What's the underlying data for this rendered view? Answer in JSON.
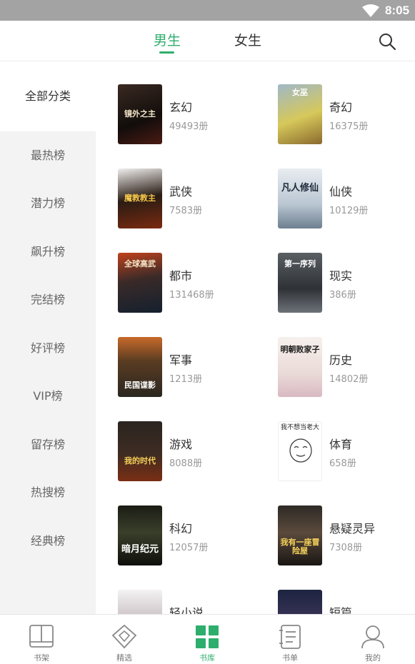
{
  "status_bar": {
    "time": "8:05"
  },
  "header": {
    "tabs": [
      {
        "label": "男生",
        "active": true
      },
      {
        "label": "女生",
        "active": false
      }
    ]
  },
  "sidebar": {
    "items": [
      {
        "label": "全部分类",
        "active": true
      },
      {
        "label": "最热榜"
      },
      {
        "label": "潜力榜"
      },
      {
        "label": "飙升榜"
      },
      {
        "label": "完结榜"
      },
      {
        "label": "好评榜"
      },
      {
        "label": "VIP榜"
      },
      {
        "label": "留存榜"
      },
      {
        "label": "热搜榜"
      },
      {
        "label": "经典榜"
      }
    ]
  },
  "categories": [
    {
      "name": "玄幻",
      "count": "49493册"
    },
    {
      "name": "奇幻",
      "count": "16375册"
    },
    {
      "name": "武侠",
      "count": "7583册"
    },
    {
      "name": "仙侠",
      "count": "10129册"
    },
    {
      "name": "都市",
      "count": "131468册"
    },
    {
      "name": "现实",
      "count": "386册"
    },
    {
      "name": "军事",
      "count": "1213册"
    },
    {
      "name": "历史",
      "count": "14802册"
    },
    {
      "name": "游戏",
      "count": "8088册"
    },
    {
      "name": "体育",
      "count": "658册"
    },
    {
      "name": "科幻",
      "count": "12057册"
    },
    {
      "name": "悬疑灵异",
      "count": "7308册"
    },
    {
      "name": "轻小说",
      "count": ""
    },
    {
      "name": "短篇",
      "count": ""
    }
  ],
  "covers": [
    {
      "title": "镜外之主"
    },
    {
      "title": "女巫"
    },
    {
      "title": "魔教教主"
    },
    {
      "title": "凡人修仙"
    },
    {
      "title": "全球高武"
    },
    {
      "title": "第一序列"
    },
    {
      "title": "民国谍影"
    },
    {
      "title": "明朝败家子"
    },
    {
      "title": "我的时代"
    },
    {
      "title": "我不想当老大"
    },
    {
      "title": "暗月纪元"
    },
    {
      "title": "我有一座冒险屋"
    },
    {
      "title": ""
    },
    {
      "title": ""
    }
  ],
  "bottom_nav": [
    {
      "label": "书架",
      "icon": "bookshelf-icon"
    },
    {
      "label": "精选",
      "icon": "diamond-icon"
    },
    {
      "label": "书库",
      "icon": "grid-icon",
      "active": true
    },
    {
      "label": "书单",
      "icon": "booklist-icon"
    },
    {
      "label": "我的",
      "icon": "profile-icon"
    }
  ],
  "colors": {
    "accent": "#2eae6c",
    "status_bar": "#a3a3a3",
    "sidebar_bg": "#f3f3f3"
  }
}
